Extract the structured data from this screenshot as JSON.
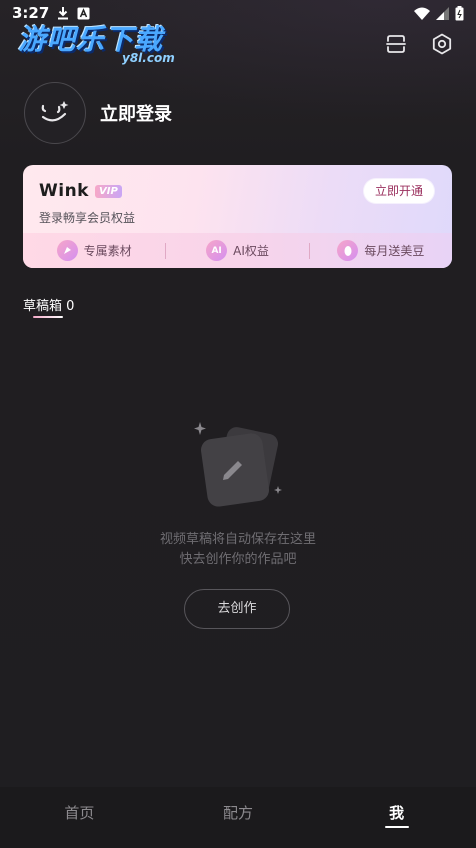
{
  "status_bar": {
    "time": "3:27"
  },
  "logo": {
    "main": "游吧乐下载",
    "sub": "y8l.com"
  },
  "header": {
    "icons": [
      "scan-icon",
      "settings-icon"
    ]
  },
  "profile": {
    "login_label": "立即登录"
  },
  "vip_card": {
    "brand": "Wink",
    "badge": "VIP",
    "subtitle": "登录畅享会员权益",
    "open_button": "立即开通",
    "perks": [
      {
        "label": "专属素材",
        "icon": "material-icon"
      },
      {
        "label": "AI权益",
        "icon": "ai-icon",
        "icon_text": "AI"
      },
      {
        "label": "每月送美豆",
        "icon": "bean-icon"
      }
    ]
  },
  "drafts": {
    "tab_label": "草稿箱 0"
  },
  "empty_state": {
    "line1": "视频草稿将自动保存在这里",
    "line2": "快去创作你的作品吧",
    "button": "去创作"
  },
  "bottom_nav": {
    "items": [
      {
        "label": "首页",
        "active": false
      },
      {
        "label": "配方",
        "active": false
      },
      {
        "label": "我",
        "active": true
      }
    ]
  },
  "colors": {
    "background": "#1f1d20",
    "accent_pink": "#f3a9c7",
    "button_text": "#9a2f5d"
  }
}
